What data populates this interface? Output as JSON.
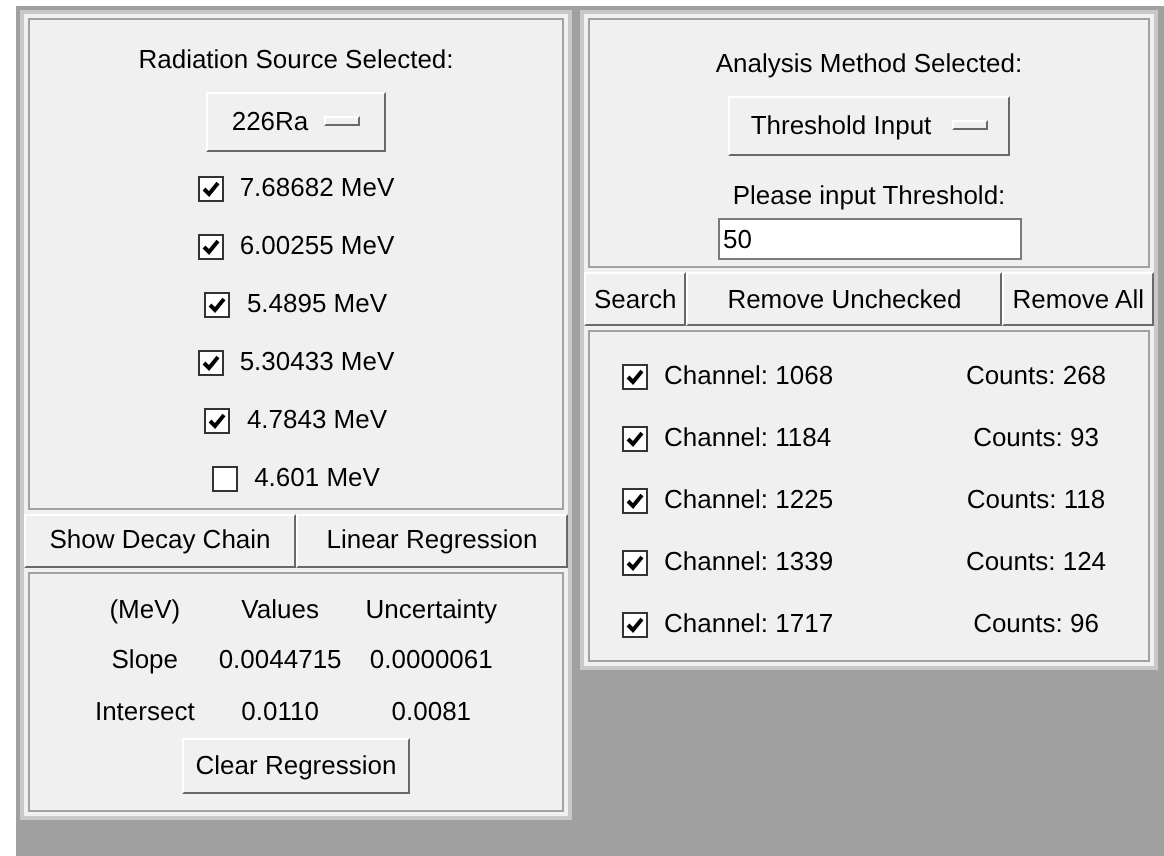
{
  "source_panel": {
    "title": "Radiation Source Selected:",
    "source_menu": "226Ra",
    "energies": [
      {
        "label": "7.68682 MeV",
        "checked": true
      },
      {
        "label": "6.00255 MeV",
        "checked": true
      },
      {
        "label": "5.4895 MeV",
        "checked": true
      },
      {
        "label": "5.30433 MeV",
        "checked": true
      },
      {
        "label": "4.7843 MeV",
        "checked": true
      },
      {
        "label": "4.601 MeV",
        "checked": false
      }
    ],
    "buttons": [
      "Show Decay Chain",
      "Linear Regression"
    ],
    "regression": {
      "columns": [
        "(MeV)",
        "Values",
        "Uncertainty"
      ],
      "rows": [
        [
          "Slope",
          "0.0044715",
          "0.0000061"
        ],
        [
          "Intersect",
          "0.0110",
          "0.0081"
        ]
      ]
    },
    "clear_button": "Clear Regression"
  },
  "analysis_panel": {
    "title": "Analysis Method Selected:",
    "method_menu": "Threshold Input",
    "threshold_label": "Please input Threshold:",
    "threshold_value": "50",
    "buttons": [
      "Search",
      "Remove Unchecked",
      "Remove All"
    ],
    "channels": [
      {
        "channel": "Channel: 1068",
        "counts": "Counts: 268",
        "checked": true
      },
      {
        "channel": "Channel: 1184",
        "counts": "Counts: 93",
        "checked": true
      },
      {
        "channel": "Channel: 1225",
        "counts": "Counts: 118",
        "checked": true
      },
      {
        "channel": "Channel: 1339",
        "counts": "Counts: 124",
        "checked": true
      },
      {
        "channel": "Channel: 1717",
        "counts": "Counts: 96",
        "checked": true
      }
    ]
  }
}
